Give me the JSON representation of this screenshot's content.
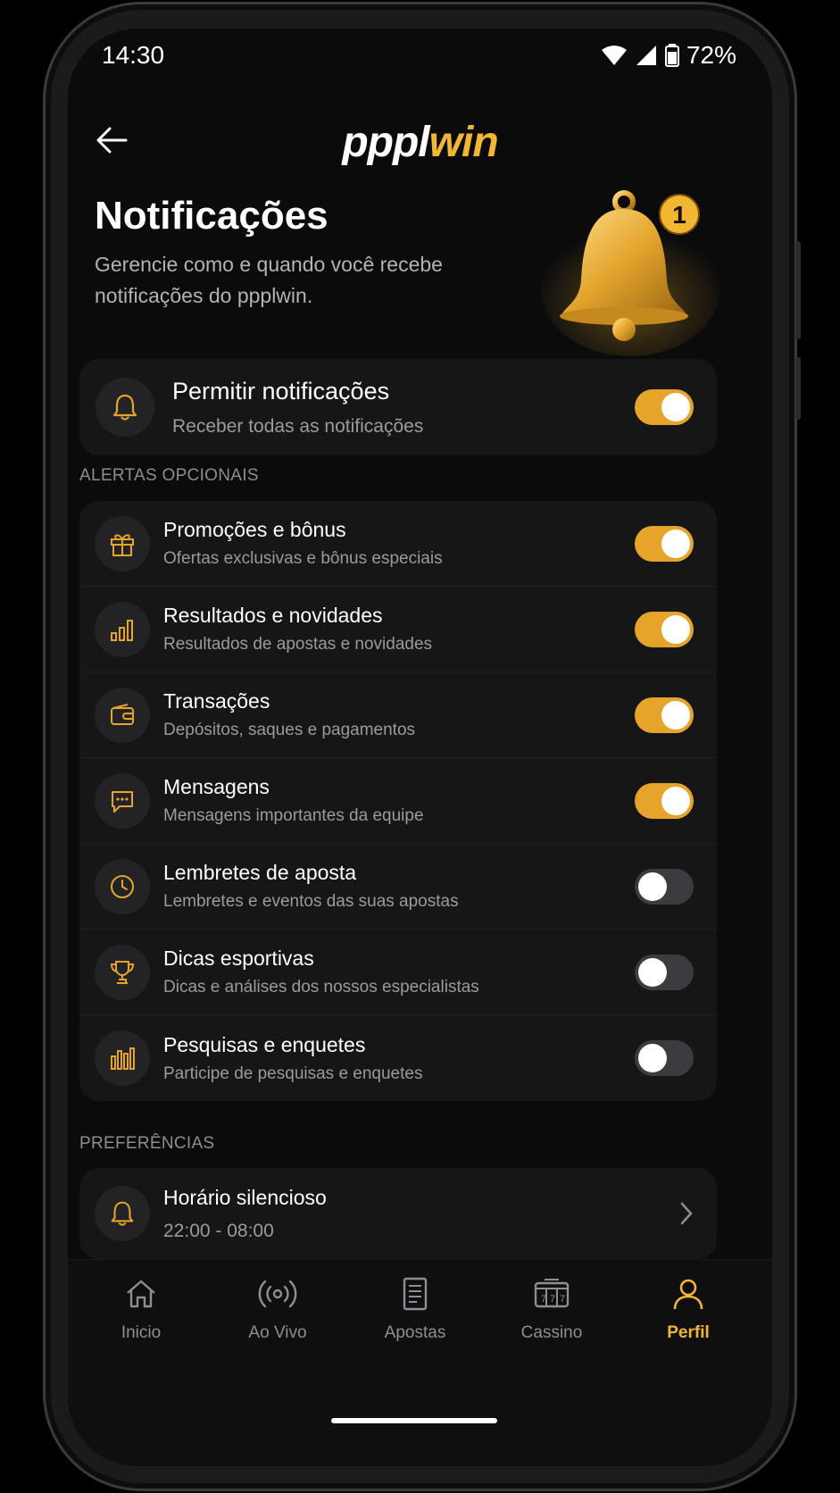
{
  "status": {
    "time": "14:30",
    "battery": "72%"
  },
  "header": {
    "logo_left": "pppl",
    "logo_right": "win"
  },
  "hero": {
    "title": "Notificações",
    "subtitle_line1": "Gerencie como e quando você recebe",
    "subtitle_line2": "notificações do ppplwin.",
    "badge_count": "1"
  },
  "master": {
    "title": "Permitir notificações",
    "subtitle": "Receber todas as notificações",
    "enabled": true
  },
  "sections": {
    "optional_label": "ALERTAS OPCIONAIS",
    "preferences_label": "PREFERÊNCIAS"
  },
  "alerts": [
    {
      "title": "Promoções e bônus",
      "subtitle": "Ofertas exclusivas e bônus especiais",
      "icon": "gift-icon",
      "enabled": true
    },
    {
      "title": "Resultados e novidades",
      "subtitle": "Resultados de apostas e novidades",
      "icon": "bar-chart-icon",
      "enabled": true
    },
    {
      "title": "Transações",
      "subtitle": "Depósitos, saques e pagamentos",
      "icon": "wallet-icon",
      "enabled": true
    },
    {
      "title": "Mensagens",
      "subtitle": "Mensagens importantes da equipe",
      "icon": "chat-icon",
      "enabled": true
    },
    {
      "title": "Lembretes de aposta",
      "subtitle": "Lembretes e eventos das suas apostas",
      "icon": "clock-icon",
      "enabled": false
    },
    {
      "title": "Dicas esportivas",
      "subtitle": "Dicas e análises dos nossos especialistas",
      "icon": "trophy-icon",
      "enabled": false
    },
    {
      "title": "Pesquisas e enquetes",
      "subtitle": "Participe de pesquisas e enquetes",
      "icon": "poll-icon",
      "enabled": false
    }
  ],
  "quiet_hours": {
    "title": "Horário silencioso",
    "value": "22:00 - 08:00"
  },
  "nav": [
    {
      "label": "Inicio",
      "icon": "home-icon"
    },
    {
      "label": "Ao Vivo",
      "icon": "live-icon"
    },
    {
      "label": "Apostas",
      "icon": "betslip-icon"
    },
    {
      "label": "Cassino",
      "icon": "slot-icon"
    },
    {
      "label": "Perfil",
      "icon": "profile-icon",
      "active": true
    }
  ],
  "colors": {
    "accent": "#f2b632",
    "toggle_on": "#e6a42b",
    "background": "#0b0b0c",
    "card": "#161617"
  }
}
